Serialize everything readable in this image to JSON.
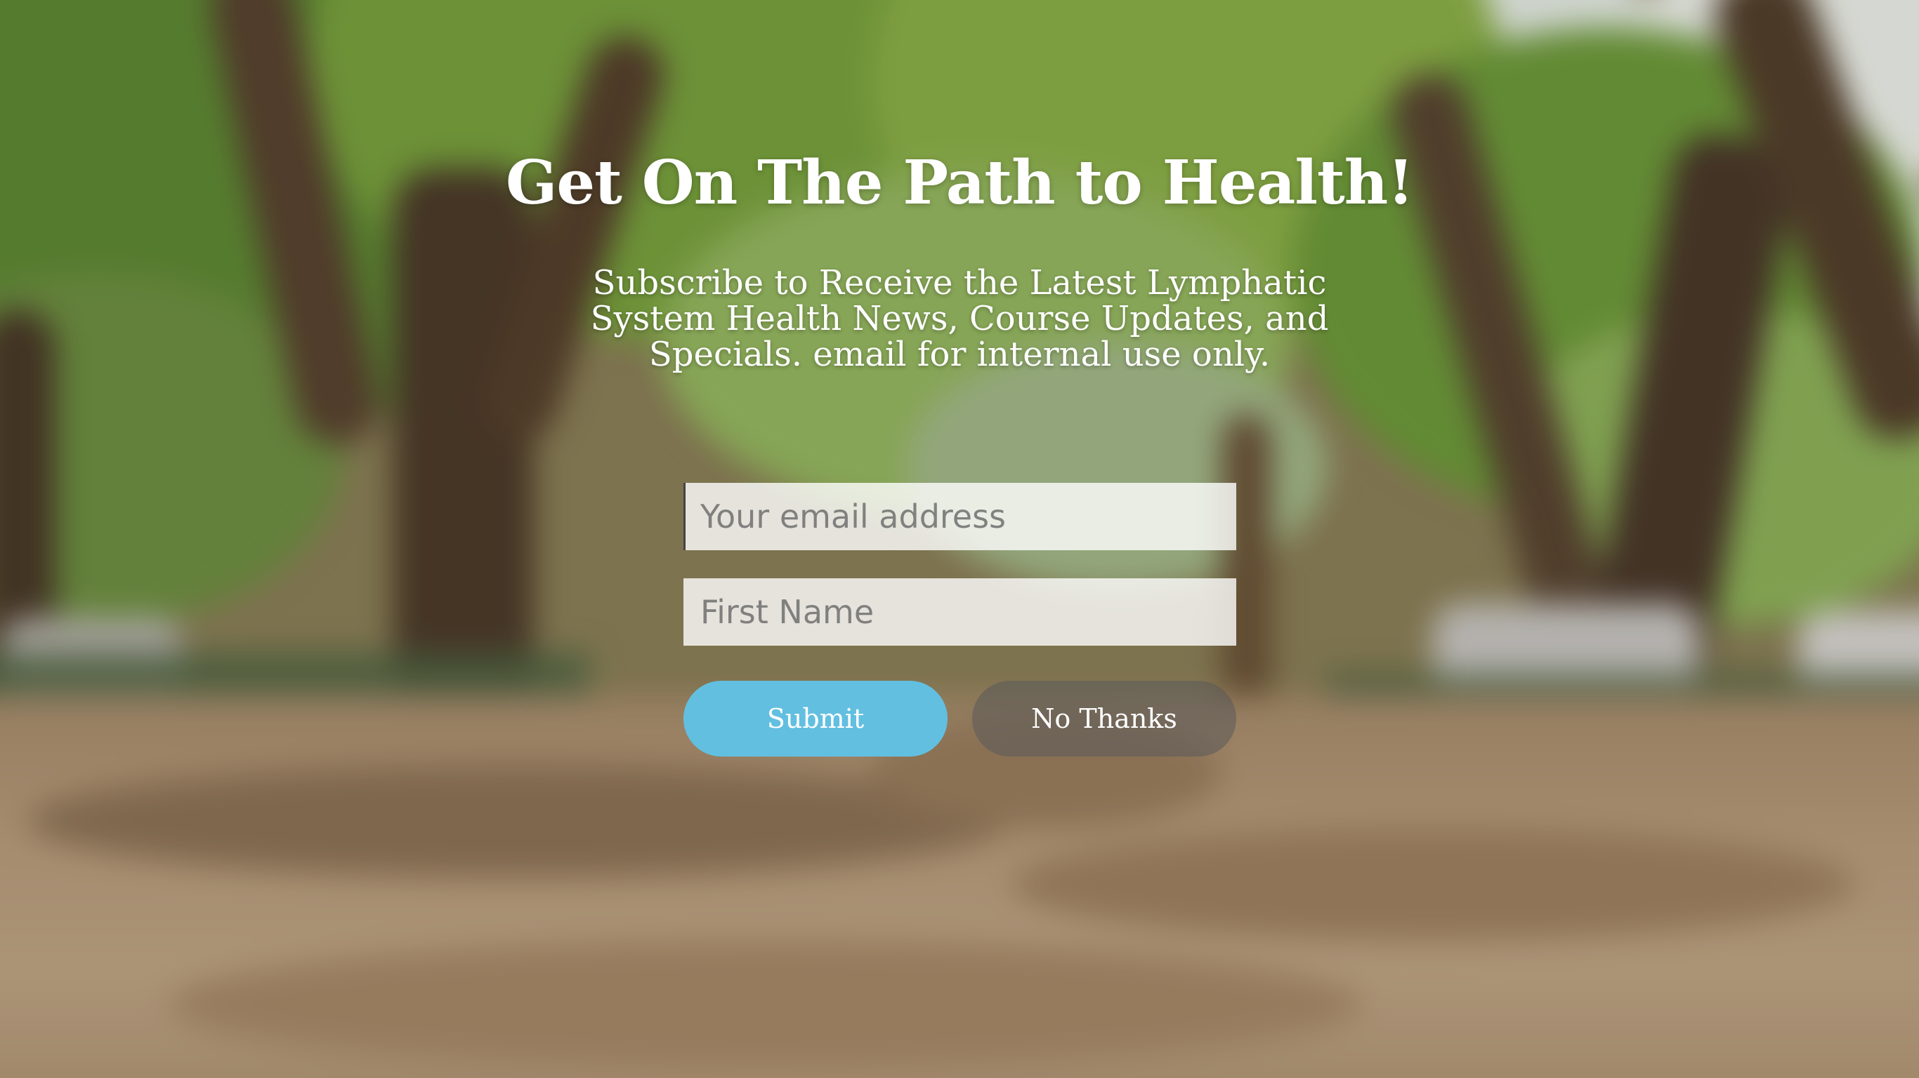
{
  "popup": {
    "headline": "Get On The Path to Health!",
    "subtext": "Subscribe to Receive the Latest Lymphatic System Health News, Course Updates, and Specials. email for internal use only.",
    "email_field": {
      "placeholder": "Your email address",
      "value": ""
    },
    "name_field": {
      "placeholder": "First Name",
      "value": ""
    },
    "submit_label": "Submit",
    "no_thanks_label": "No Thanks"
  },
  "colors": {
    "submit_button": "#62bfe0",
    "no_thanks_button": "rgba(90,90,90,0.55)",
    "text": "#ffffff"
  },
  "background": {
    "description_icon": "park-photo-background"
  }
}
